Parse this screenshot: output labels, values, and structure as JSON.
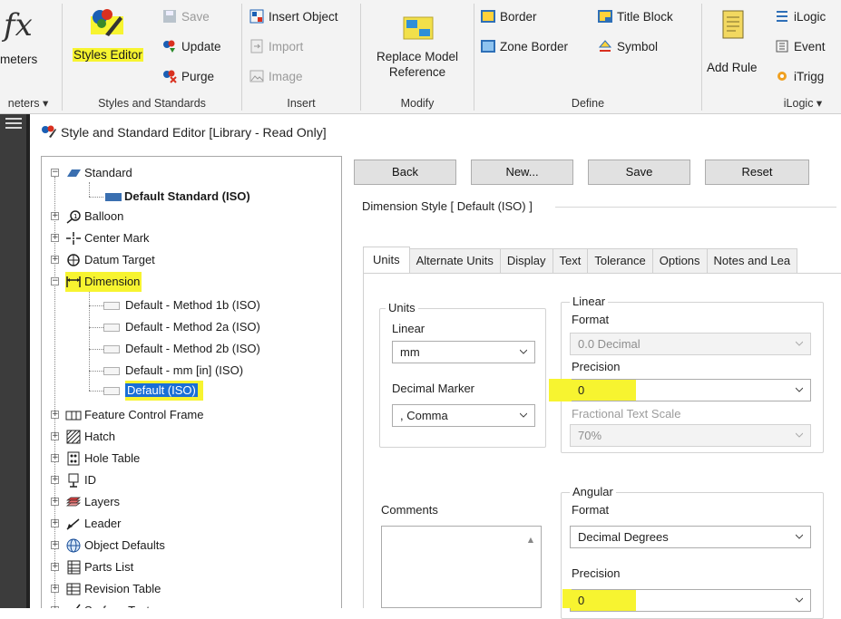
{
  "ribbon": {
    "params_icon": "fx",
    "params_label": "meters",
    "params_group_label": "neters ▾",
    "styles_group": {
      "styles_editor_label": "Styles Editor",
      "save_label": "Save",
      "update_label": "Update",
      "purge_label": "Purge",
      "group_label": "Styles and Standards"
    },
    "insert_group": {
      "insert_object_label": "Insert Object",
      "import_label": "Import",
      "image_label": "Image",
      "group_label": "Insert"
    },
    "modify_group": {
      "replace_label_1": "Replace Model",
      "replace_label_2": "Reference",
      "group_label": "Modify"
    },
    "define_group": {
      "border_label": "Border",
      "zone_border_label": "Zone Border",
      "title_block_label": "Title Block",
      "symbol_label": "Symbol",
      "group_label": "Define"
    },
    "ilogic_group": {
      "add_rule_label": "Add Rule",
      "ilogic_label": "iLogic",
      "event_label": "Event",
      "itrigger_label": "iTrigg",
      "group_label": "iLogic ▾"
    }
  },
  "window": {
    "title": "Style and Standard Editor [Library - Read Only]"
  },
  "tree": {
    "standard": "Standard",
    "default_standard": "Default Standard (ISO)",
    "balloon": "Balloon",
    "center_mark": "Center Mark",
    "datum_target": "Datum Target",
    "dimension": "Dimension",
    "dim_children": [
      "Default - Method 1b (ISO)",
      "Default - Method 2a (ISO)",
      "Default - Method 2b (ISO)",
      "Default - mm [in] (ISO)",
      "Default (ISO)"
    ],
    "others": [
      "Feature Control Frame",
      "Hatch",
      "Hole Table",
      "ID",
      "Layers",
      "Leader",
      "Object Defaults",
      "Parts List",
      "Revision Table",
      "Surface Texture"
    ]
  },
  "toolbar": {
    "back": "Back",
    "new": "New...",
    "save": "Save",
    "reset": "Reset"
  },
  "dimension_style_label": "Dimension Style [ Default (ISO) ]",
  "tabs": [
    "Units",
    "Alternate Units",
    "Display",
    "Text",
    "Tolerance",
    "Options",
    "Notes and Lea"
  ],
  "units_group": {
    "title": "Units",
    "linear_label": "Linear",
    "linear_value": "mm",
    "decimal_marker_label": "Decimal Marker",
    "decimal_marker_value": ", Comma"
  },
  "linear_group": {
    "title": "Linear",
    "format_label": "Format",
    "format_value": "0.0 Decimal",
    "precision_label": "Precision",
    "precision_value": "0",
    "fractional_label": "Fractional Text Scale",
    "fractional_value": "70%"
  },
  "comments_label": "Comments",
  "angular_group": {
    "title": "Angular",
    "format_label": "Format",
    "format_value": "Decimal Degrees",
    "precision_label": "Precision",
    "precision_value": "0"
  },
  "colors": {
    "highlight": "#f7f430",
    "selection": "#1a6fd6"
  }
}
